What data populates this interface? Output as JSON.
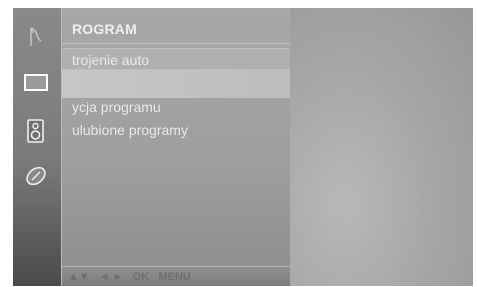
{
  "menu": {
    "title": "ROGRAM",
    "items": [
      {
        "label": "trojenie auto"
      },
      {
        "label": ""
      },
      {
        "label": "ycja programu"
      },
      {
        "label": "ulubione programy"
      }
    ]
  },
  "hint_bar": {
    "keys": [
      "▲▼",
      "◄ ►",
      "OK",
      "MENU"
    ]
  },
  "sidebar": {
    "icons": [
      "program-icon",
      "picture-icon",
      "sound-icon",
      "time-icon"
    ]
  },
  "colors": {
    "menu_text": "#e9e9e9",
    "selected_row": "#c6c6c6"
  }
}
